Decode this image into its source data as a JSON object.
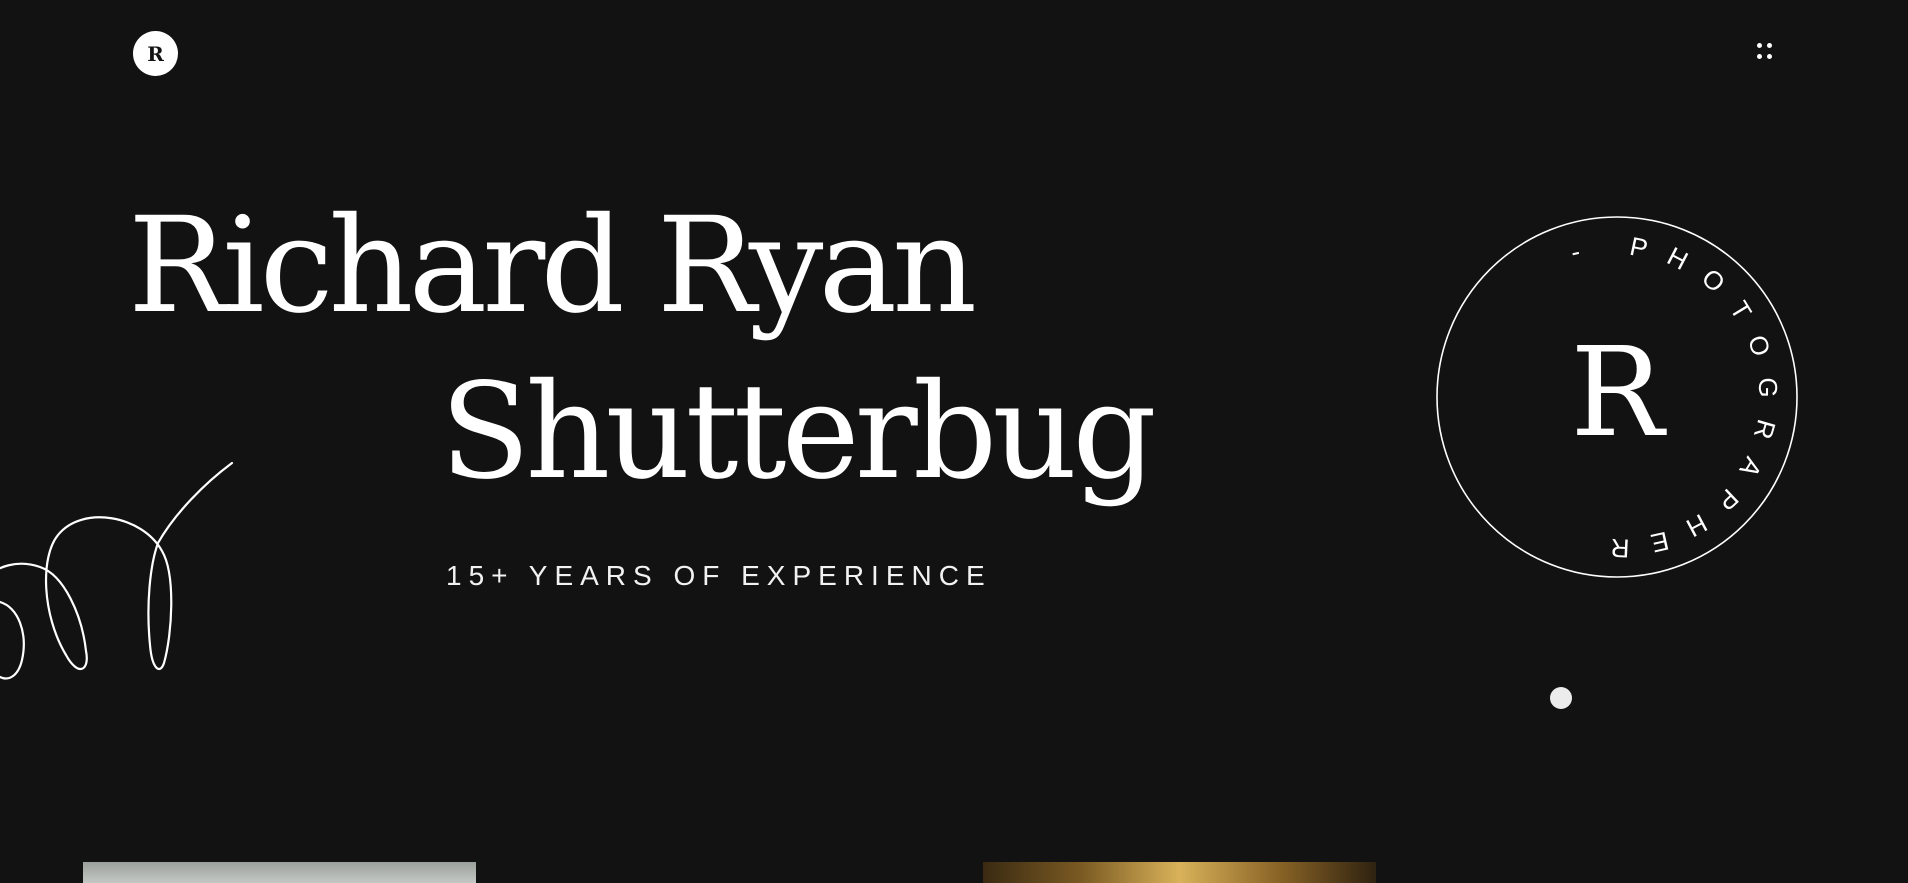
{
  "header": {
    "logo_letter": "R",
    "menu_icon": "grid-dots-icon"
  },
  "hero": {
    "title_line_1": "Richard Ryan",
    "title_line_2": "Shutterbug",
    "subtitle": "15+ YEARS OF EXPERIENCE",
    "decoration_icon": "scribble-line-icon"
  },
  "badge": {
    "center_letter": "R",
    "ring_text": "- PHOTOGRAPHER"
  },
  "colors": {
    "background": "#121212",
    "foreground": "#ffffff"
  }
}
